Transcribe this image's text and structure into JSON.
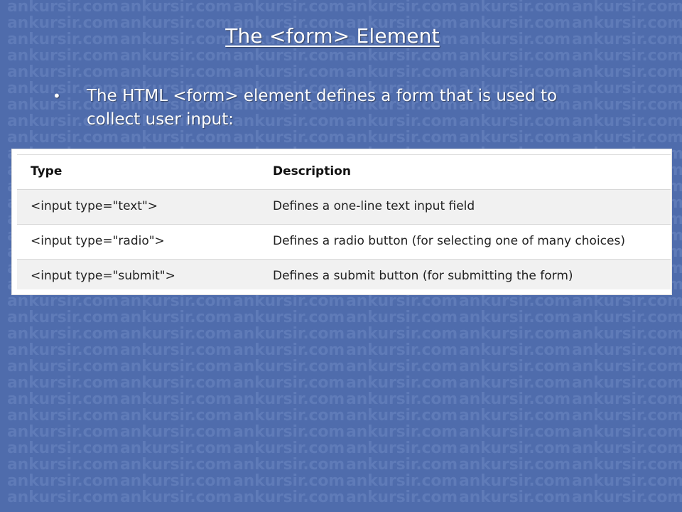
{
  "slide": {
    "title": "The <form> Element",
    "bullet_symbol": "•",
    "bullet_text": "The HTML <form> element defines a form that is used to collect user input:"
  },
  "table": {
    "headers": [
      "Type",
      "Description"
    ],
    "rows": [
      [
        "<input type=\"text\">",
        "Defines a one-line text input field"
      ],
      [
        "<input type=\"radio\">",
        "Defines a radio button (for selecting one of many choices)"
      ],
      [
        "<input type=\"submit\">",
        "Defines a submit button (for submitting the form)"
      ]
    ]
  },
  "watermark": {
    "text": "ankursir.com"
  },
  "colors": {
    "background": "#4f6cac",
    "watermark": "#5f7bb8",
    "table_background": "#ffffff",
    "table_alt_row": "#f1f1f1"
  }
}
